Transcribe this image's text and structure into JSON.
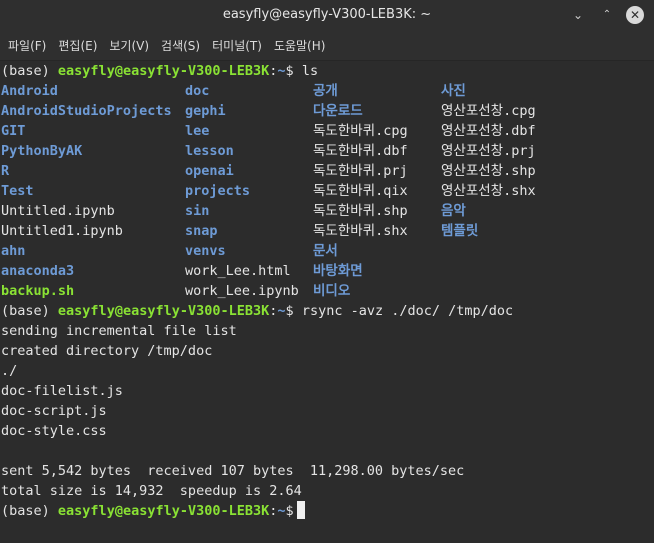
{
  "window": {
    "title": "easyfly@easyfly-V300-LEB3K: ~",
    "buttons": {
      "minimize": "⌄",
      "maximize": "⌃",
      "close": "✕"
    }
  },
  "menu": [
    "파일(F)",
    "편집(E)",
    "보기(V)",
    "검색(S)",
    "터미널(T)",
    "도움말(H)"
  ],
  "prompt": {
    "env": "(base)",
    "user_host": "easyfly@easyfly-V300-LEB3K",
    "sep": ":",
    "path": "~",
    "symbol": "$"
  },
  "commands": {
    "ls": "ls",
    "rsync": "rsync -avz ./doc/ /tmp/doc"
  },
  "ls_rows": [
    [
      "Android",
      "doc",
      "공개",
      "사진"
    ],
    [
      "AndroidStudioProjects",
      "gephi",
      "다운로드",
      "영산포선창.cpg"
    ],
    [
      "GIT",
      "lee",
      "독도한바퀴.cpg",
      "영산포선창.dbf"
    ],
    [
      "PythonByAK",
      "lesson",
      "독도한바퀴.dbf",
      "영산포선창.prj"
    ],
    [
      "R",
      "openai",
      "독도한바퀴.prj",
      "영산포선창.shp"
    ],
    [
      "Test",
      "projects",
      "독도한바퀴.qix",
      "영산포선창.shx"
    ],
    [
      "Untitled.ipynb",
      "sin",
      "독도한바퀴.shp",
      "음악"
    ],
    [
      "Untitled1.ipynb",
      "snap",
      "독도한바퀴.shx",
      "템플릿"
    ],
    [
      "ahn",
      "venvs",
      "문서",
      ""
    ],
    [
      "anaconda3",
      "work_Lee.html",
      "바탕화면",
      ""
    ],
    [
      "backup.sh",
      "work_Lee.ipynb",
      "비디오",
      ""
    ]
  ],
  "ls_types": [
    [
      "dir",
      "dir",
      "dir",
      "dir"
    ],
    [
      "dir",
      "dir",
      "dir",
      "file"
    ],
    [
      "dir",
      "dir",
      "file",
      "file"
    ],
    [
      "dir",
      "dir",
      "file",
      "file"
    ],
    [
      "dir",
      "dir",
      "file",
      "file"
    ],
    [
      "dir",
      "dir",
      "file",
      "file"
    ],
    [
      "file",
      "dir",
      "file",
      "dir"
    ],
    [
      "file",
      "dir",
      "file",
      "dir"
    ],
    [
      "dir",
      "dir",
      "dir",
      ""
    ],
    [
      "dir",
      "file",
      "dir",
      ""
    ],
    [
      "exec",
      "file",
      "dir",
      ""
    ]
  ],
  "rsync_output": [
    "sending incremental file list",
    "created directory /tmp/doc",
    "./",
    "doc-filelist.js",
    "doc-script.js",
    "doc-style.css",
    "",
    "sent 5,542 bytes  received 107 bytes  11,298.00 bytes/sec",
    "total size is 14,932  speedup is 2.64"
  ],
  "colors": {
    "background": "#2c2c2c",
    "text": "#e4e4e4",
    "directory": "#6e9bd6",
    "prompt_user": "#8ae234",
    "executable": "#8ae234"
  }
}
